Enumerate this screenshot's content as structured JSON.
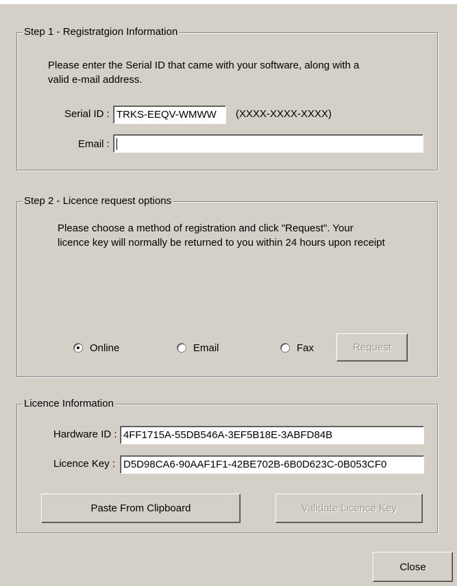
{
  "step1": {
    "legend": "Step 1 - Registratgion Information",
    "instruction_line1": "Please enter the Serial ID that came with your software, along with a",
    "instruction_line2": "valid e-mail address.",
    "serial_label": "Serial ID :",
    "serial_value": "TRKS-EEQV-WMWW",
    "serial_format_hint": "(XXXX-XXXX-XXXX)",
    "email_label": "Email :",
    "email_value": ""
  },
  "step2": {
    "legend": "Step 2 - Licence request options",
    "instruction_line1": "Please choose a method of registration and click \"Request\". Your",
    "instruction_line2": "licence key will normally be returned to you within 24 hours upon receipt",
    "options": [
      {
        "label": "Online",
        "checked": true
      },
      {
        "label": "Email",
        "checked": false
      },
      {
        "label": "Fax",
        "checked": false
      }
    ],
    "request_button": "Request"
  },
  "licence": {
    "legend": "Licence Information",
    "hardware_label": "Hardware ID :",
    "hardware_value": "4FF1715A-55DB546A-3EF5B18E-3ABFD84B",
    "key_label": "Licence Key :",
    "key_value": "D5D98CA6-90AAF1F1-42BE702B-6B0D623C-0B053CF0",
    "paste_button": "Paste From Clipboard",
    "validate_button": "Validate Licence Key"
  },
  "close_button": "Close"
}
